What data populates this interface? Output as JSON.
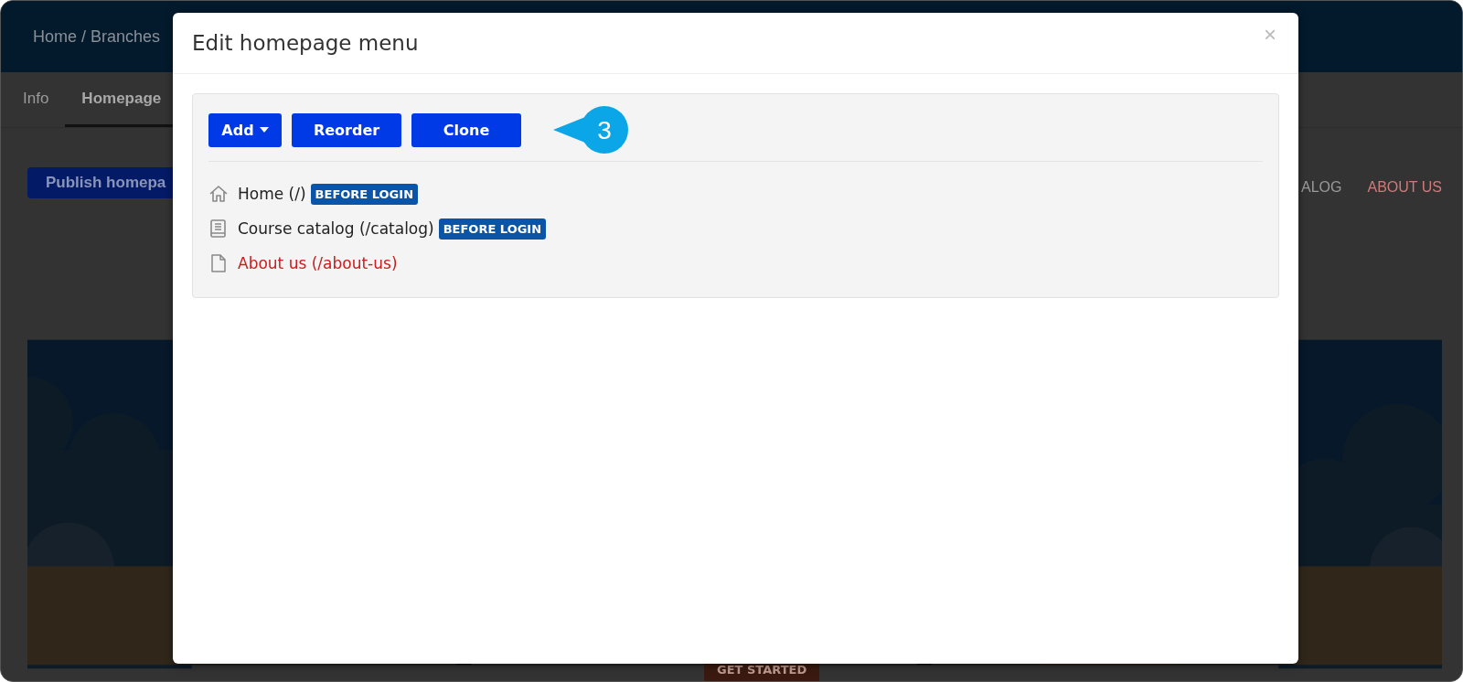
{
  "page": {
    "breadcrumb": "Home / Branches",
    "tabs": [
      {
        "label": "Info",
        "selected": false
      },
      {
        "label": "Homepage",
        "selected": true
      }
    ],
    "publish_button": "Publish homepa",
    "nav": [
      {
        "label": "ALOG",
        "kind": "plain"
      },
      {
        "label": "ABOUT US",
        "kind": "accent"
      }
    ],
    "hero": {
      "kind": "picture",
      "button": "GET STARTED"
    }
  },
  "modal": {
    "title": "Edit homepage menu",
    "close": "×",
    "buttons": [
      {
        "label": "Add",
        "kind": "dropdown"
      },
      {
        "label": "Reorder",
        "kind": "plain"
      },
      {
        "label": "Clone",
        "kind": "plain"
      }
    ],
    "callout": "3",
    "items": [
      {
        "label": "Home (/)",
        "badge": "BEFORE LOGIN",
        "kind": "normal"
      },
      {
        "label": "Course catalog (/catalog)",
        "badge": "BEFORE LOGIN",
        "kind": "normal"
      },
      {
        "label": "About us (/about-us)",
        "kind": "warning"
      }
    ]
  }
}
